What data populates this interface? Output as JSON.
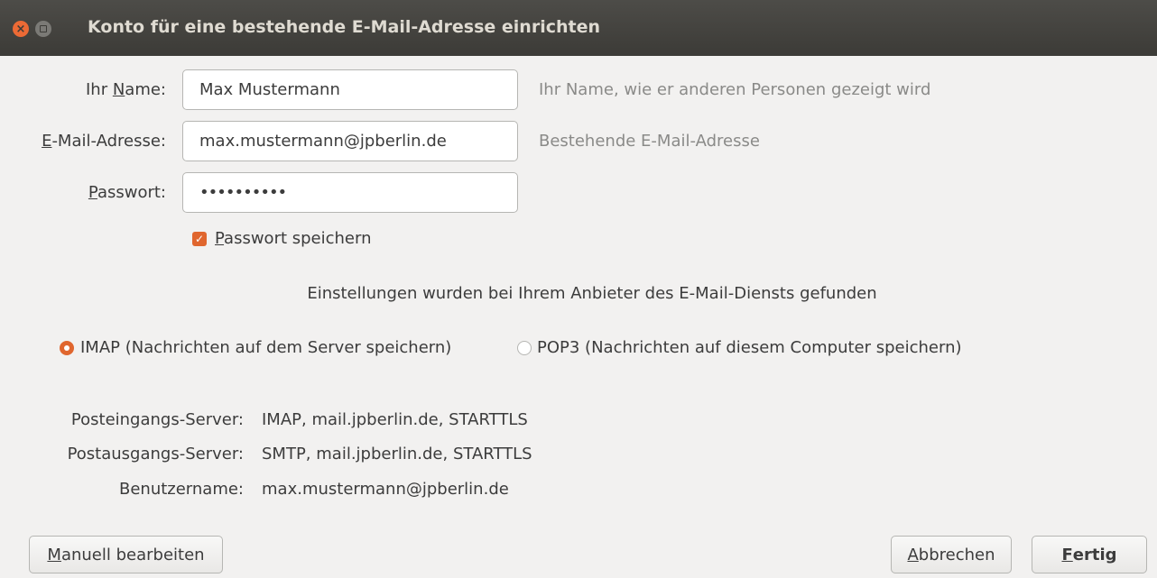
{
  "window": {
    "title": "Konto für eine bestehende E-Mail-Adresse einrichten",
    "close_glyph": "×"
  },
  "form": {
    "name": {
      "label_pre": "Ihr ",
      "label_u": "N",
      "label_post": "ame:",
      "value": "Max Mustermann",
      "hint": "Ihr Name, wie er anderen Personen gezeigt wird"
    },
    "email": {
      "label_pre": "",
      "label_u": "E",
      "label_post": "-Mail-Adresse:",
      "value": "max.mustermann@jpberlin.de",
      "hint": "Bestehende E-Mail-Adresse"
    },
    "password": {
      "label_pre": "",
      "label_u": "P",
      "label_post": "asswort:",
      "value": "••••••••••"
    },
    "save_password": {
      "checked": true,
      "check_glyph": "✓",
      "label_u": "P",
      "label_post": "asswort speichern"
    }
  },
  "info_text": "Einstellungen wurden bei Ihrem Anbieter des E-Mail-Diensts gefunden",
  "protocols": {
    "imap": {
      "label": "IMAP (Nachrichten auf dem Server speichern)",
      "selected": true
    },
    "pop3": {
      "label": "POP3 (Nachrichten auf diesem Computer speichern)",
      "selected": false
    }
  },
  "servers": [
    {
      "label": "Posteingangs-Server:",
      "value": "IMAP, mail.jpberlin.de, STARTTLS"
    },
    {
      "label": "Postausgangs-Server:",
      "value": "SMTP, mail.jpberlin.de, STARTTLS"
    },
    {
      "label": "Benutzername:",
      "value": "max.mustermann@jpberlin.de"
    }
  ],
  "buttons": {
    "manual": {
      "u": "M",
      "rest": "anuell bearbeiten"
    },
    "cancel": {
      "u": "A",
      "rest": "bbrechen"
    },
    "done": {
      "u": "F",
      "rest": "ertig"
    }
  },
  "colors": {
    "accent": "#e0662e",
    "titlebar": "#3c3b37"
  }
}
